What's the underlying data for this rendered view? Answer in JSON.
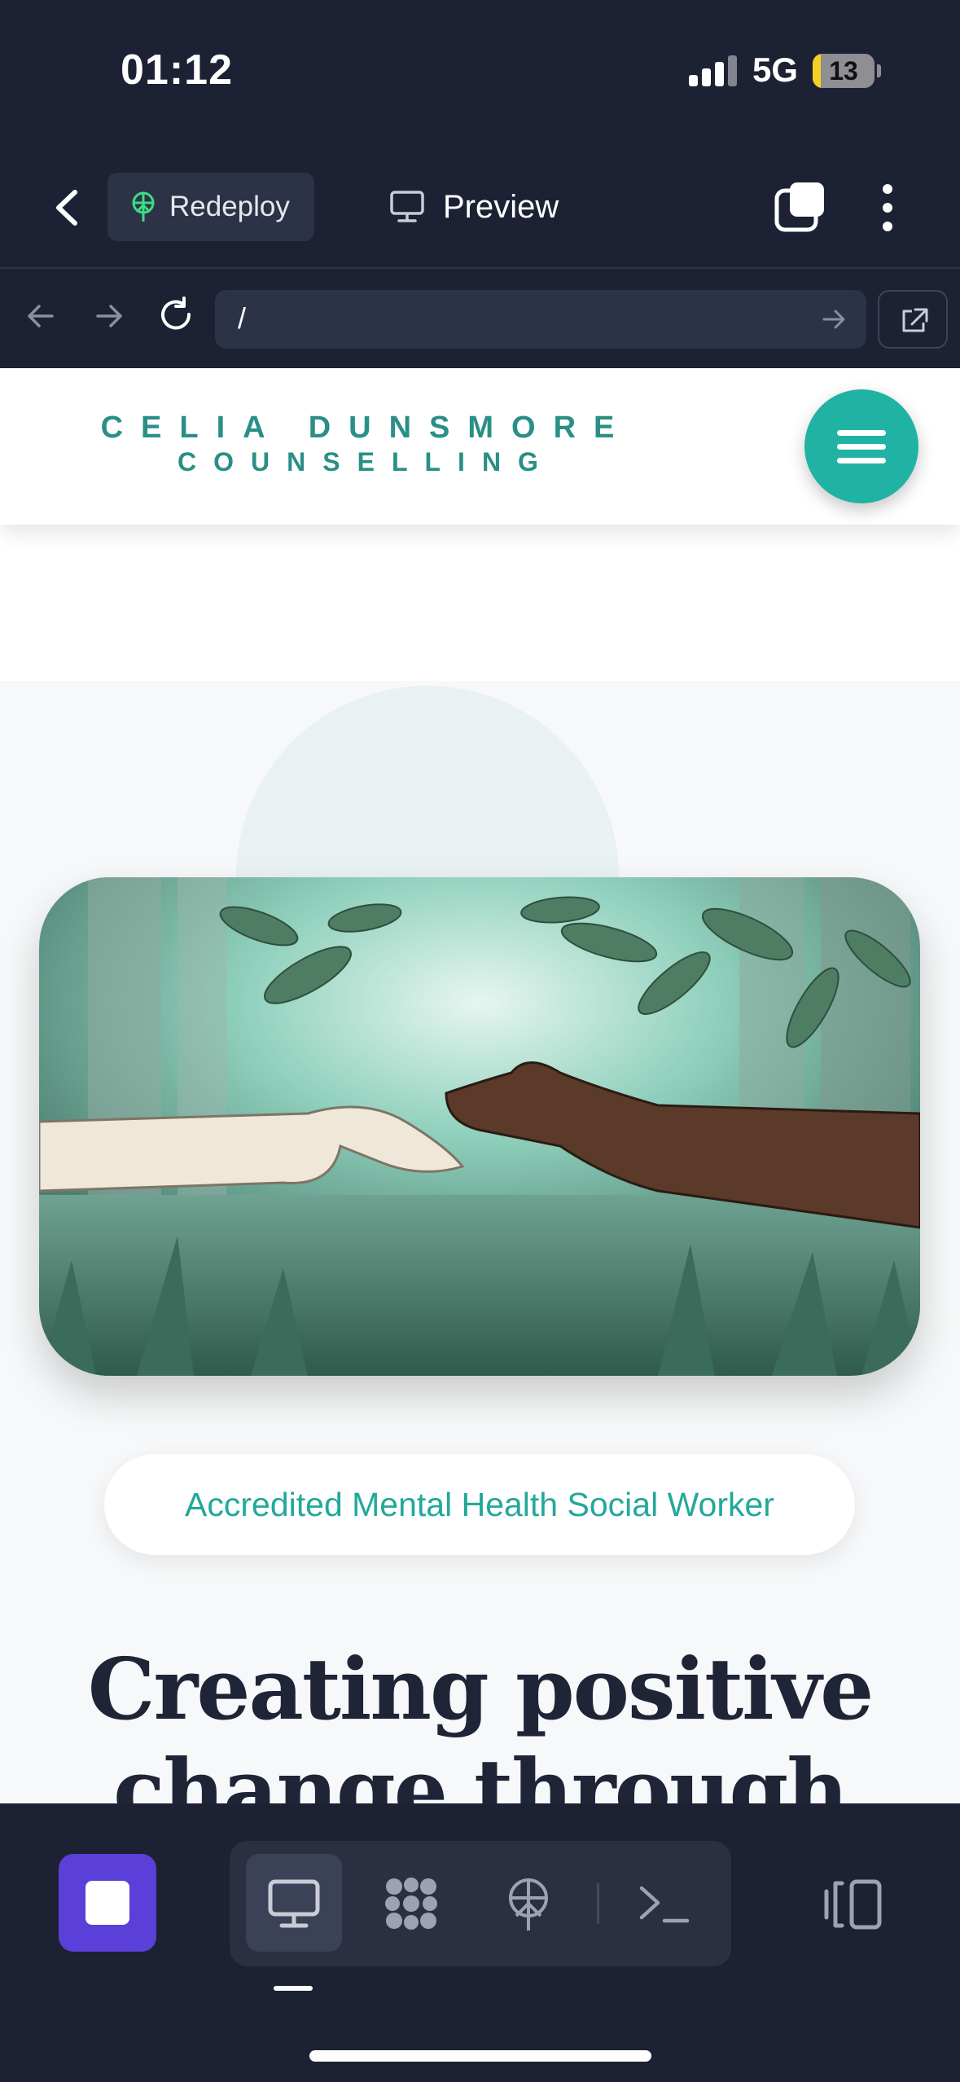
{
  "status_bar": {
    "time": "01:12",
    "network": "5G",
    "battery": "13",
    "battery_level": 0.13
  },
  "app_header": {
    "redeploy_label": "Redeploy",
    "preview_label": "Preview"
  },
  "browser": {
    "url": "/"
  },
  "site": {
    "logo_line1": "CELIA DUNSMORE",
    "logo_line2": "COUNSELLING",
    "badge": "Accredited Mental Health Social Worker",
    "hero_title_line1": "Creating positive",
    "hero_title_line2": "change through",
    "accent_color": "#20b3a3",
    "hero_image": "illustrated-hands-reaching-forest"
  },
  "toolbar": {
    "tools": [
      "desktop-icon",
      "dots-grid-icon",
      "deploy-tree-icon",
      "terminal-icon"
    ],
    "active_tool": "desktop-icon"
  }
}
